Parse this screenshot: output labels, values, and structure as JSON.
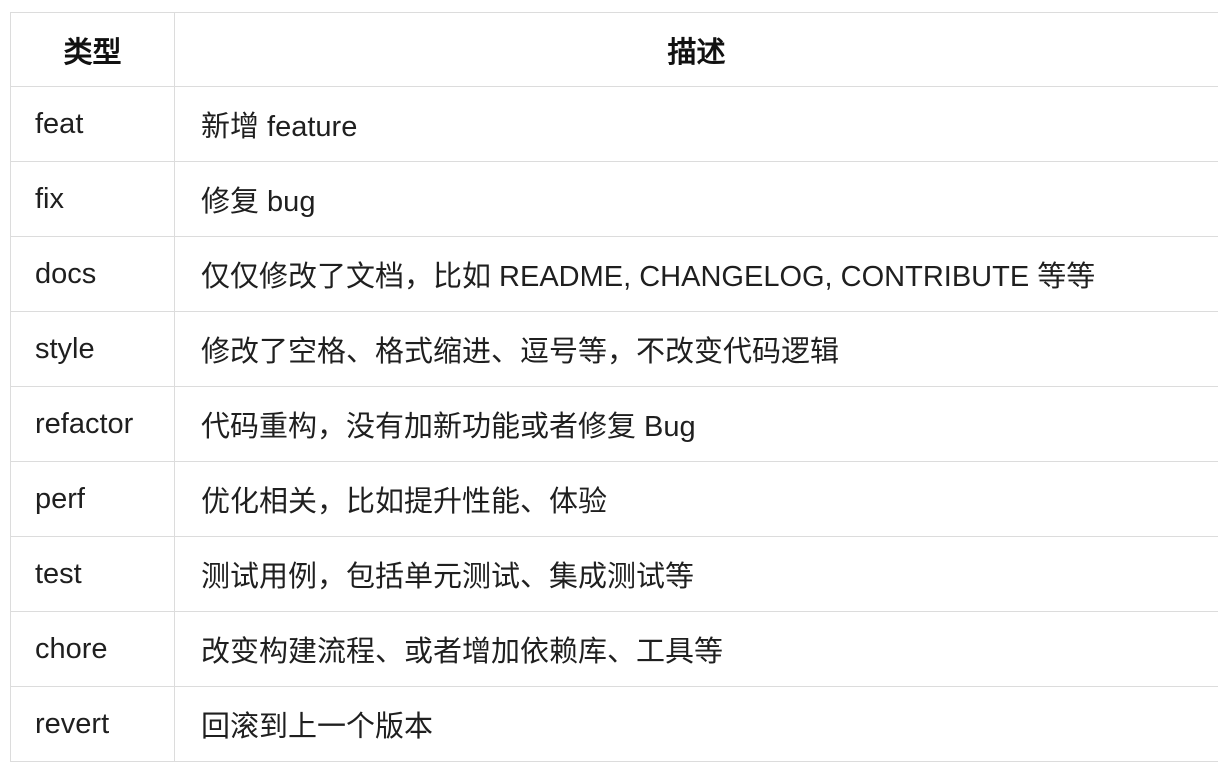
{
  "table": {
    "headers": {
      "type": "类型",
      "description": "描述"
    },
    "rows": [
      {
        "type": "feat",
        "description": "新增 feature"
      },
      {
        "type": "fix",
        "description": "修复 bug"
      },
      {
        "type": "docs",
        "description": "仅仅修改了文档，比如 README, CHANGELOG, CONTRIBUTE 等等"
      },
      {
        "type": "style",
        "description": "修改了空格、格式缩进、逗号等，不改变代码逻辑"
      },
      {
        "type": "refactor",
        "description": "代码重构，没有加新功能或者修复 Bug"
      },
      {
        "type": "perf",
        "description": "优化相关，比如提升性能、体验"
      },
      {
        "type": "test",
        "description": "测试用例，包括单元测试、集成测试等"
      },
      {
        "type": "chore",
        "description": "改变构建流程、或者增加依赖库、工具等"
      },
      {
        "type": "revert",
        "description": "回滚到上一个版本"
      }
    ]
  }
}
